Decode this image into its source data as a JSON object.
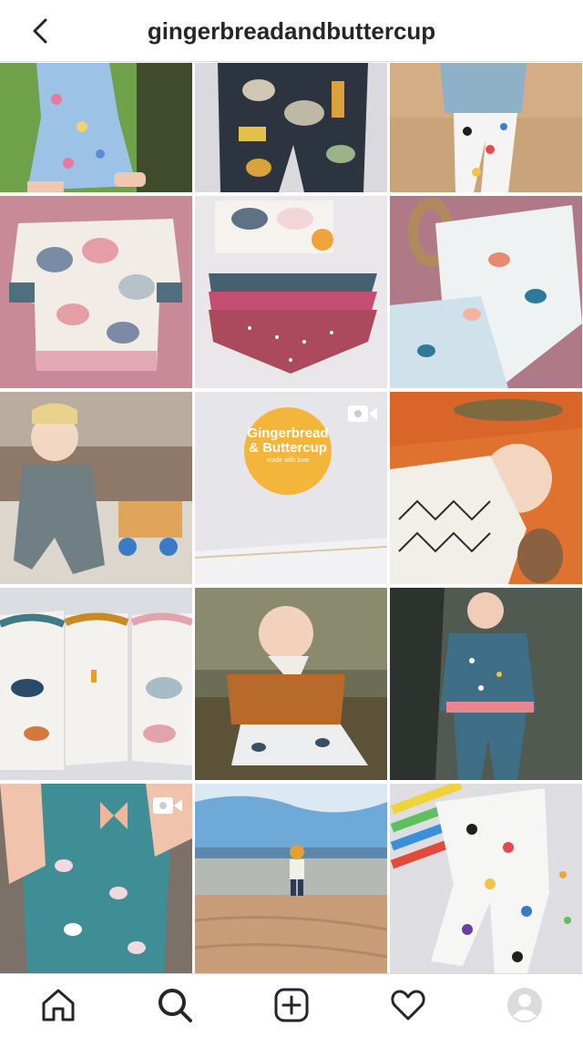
{
  "header": {
    "title": "gingerbreadandbuttercup",
    "back_icon": "chevron-left-icon"
  },
  "grid": {
    "tiles": [
      {
        "name": "girl-in-floral-dress",
        "video": false
      },
      {
        "name": "safari-print-leggings",
        "video": false
      },
      {
        "name": "child-in-leopard-leggings",
        "video": false
      },
      {
        "name": "elephant-print-sweater",
        "video": false
      },
      {
        "name": "bandana-bibs-and-bows",
        "video": false
      },
      {
        "name": "floral-bandana-with-teether",
        "video": false
      },
      {
        "name": "baby-with-toy-blocks",
        "video": false
      },
      {
        "name": "gingerbread-and-buttercup-logo",
        "video": true,
        "logo_line1": "Gingerbread",
        "logo_line2": "& Buttercup",
        "logo_tagline": "made with love"
      },
      {
        "name": "smiling-baby-on-orange-blanket",
        "video": false
      },
      {
        "name": "dinosaur-and-bee-rompers",
        "video": false
      },
      {
        "name": "baby-in-mustard-top",
        "video": false
      },
      {
        "name": "girl-in-unicorn-outfit",
        "video": false
      },
      {
        "name": "floral-romper-with-bow",
        "video": true
      },
      {
        "name": "toddler-on-beach",
        "video": false
      },
      {
        "name": "rainbow-leopard-leggings",
        "video": false
      }
    ]
  },
  "bottom_nav": {
    "items": [
      {
        "name": "home",
        "icon": "home-icon"
      },
      {
        "name": "search",
        "icon": "search-icon"
      },
      {
        "name": "new-post",
        "icon": "add-post-icon"
      },
      {
        "name": "activity",
        "icon": "heart-icon"
      },
      {
        "name": "profile",
        "icon": "avatar-icon"
      }
    ]
  },
  "colors": {
    "text": "#262626",
    "divider": "#dbdbdb",
    "background": "#ffffff"
  }
}
